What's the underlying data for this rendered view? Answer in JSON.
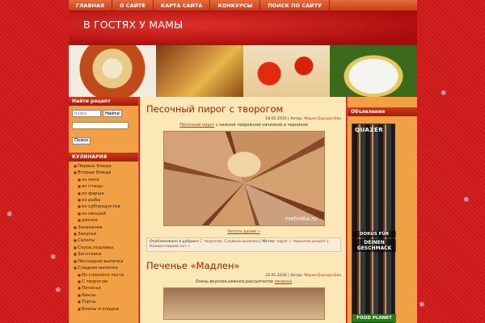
{
  "nav": {
    "items": [
      "ГЛАВНАЯ",
      "О САЙТЕ",
      "КАРТА САЙТА",
      "КОНКУРСЫ",
      "ПОИСК ПО САЙТУ"
    ]
  },
  "site": {
    "title": "В ГОСТЯХ У МАМЫ"
  },
  "left_sidebar": {
    "find_recipe_title": "Найти рецепт",
    "search_placeholder": "поиск",
    "search_button": "Найти",
    "search2_button": "Поиск",
    "cooking_title": "КУЛИНАРИЯ",
    "categories": [
      {
        "label": "Первые блюда",
        "sub": false
      },
      {
        "label": "Вторые блюда",
        "sub": false
      },
      {
        "label": "из мяса",
        "sub": true
      },
      {
        "label": "из птицы",
        "sub": true
      },
      {
        "label": "из фарша",
        "sub": true
      },
      {
        "label": "из рыбы",
        "sub": true
      },
      {
        "label": "из субпродуктов",
        "sub": true
      },
      {
        "label": "из овощей",
        "sub": true
      },
      {
        "label": "разное",
        "sub": true
      },
      {
        "label": "Запеканки",
        "sub": false
      },
      {
        "label": "Закуски",
        "sub": false
      },
      {
        "label": "Салаты",
        "sub": false
      },
      {
        "label": "Соусы,подливы",
        "sub": false
      },
      {
        "label": "Заготовки",
        "sub": false
      },
      {
        "label": "Несладкая выпечка",
        "sub": false
      },
      {
        "label": "Сладкая выпечка",
        "sub": false
      },
      {
        "label": "Из слоеного теста",
        "sub": true
      },
      {
        "label": "С творогом",
        "sub": true
      },
      {
        "label": "Печенье",
        "sub": true
      },
      {
        "label": "Кексы",
        "sub": true
      },
      {
        "label": "Торты",
        "sub": true
      },
      {
        "label": "Блины и оладьи",
        "sub": true
      }
    ]
  },
  "right_sidebar": {
    "ad_title": "Объявления",
    "ad_brand": "QUAZER",
    "ad_dokus": "DOKUS FÜR",
    "ad_geschmack": "DEINEN GESCHMACK",
    "ad_footer": "FOOD PLANET"
  },
  "posts": [
    {
      "title": "Песочный пирог с творогом",
      "date": "18.02.2016",
      "author_label": "Автор:",
      "author": "Мария Бородачёва",
      "lead_link": "Песочный пирог",
      "lead_rest": " с нежной творожной начинкой и черникой",
      "watermark": "mehnika.ru",
      "more": "Читать далее »",
      "footer_published": "Опубликовано в рубрике",
      "footer_cats": "С творогом, Сладкая выпечка",
      "footer_tags_label": "Метки:",
      "footer_tags": "пирог с творогом рецепт",
      "footer_comments": "Комментариев нет »"
    },
    {
      "title": "Печенье «Мадлен»",
      "date": "22.01.2016",
      "author_label": "Автор:",
      "author": "Мария Бородачёва",
      "lead_text": "Очень вкусное,нежное,рассыпчатое ",
      "lead_link": "печенье"
    }
  ]
}
